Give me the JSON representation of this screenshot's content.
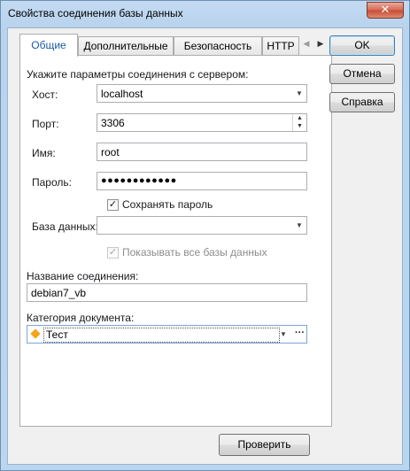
{
  "window": {
    "title": "Свойства соединения базы данных",
    "close_glyph": "✕"
  },
  "tabs": [
    {
      "label": "Общие",
      "active": true
    },
    {
      "label": "Дополнительные",
      "active": false
    },
    {
      "label": "Безопасность",
      "active": false
    },
    {
      "label": "HTTP",
      "active": false
    }
  ],
  "tab_scroll": {
    "left_glyph": "◀",
    "right_glyph": "▶"
  },
  "form": {
    "section_label": "Укажите параметры соединения с сервером:",
    "host": {
      "label": "Хост:",
      "value": "localhost"
    },
    "port": {
      "label": "Порт:",
      "value": "3306"
    },
    "user": {
      "label": "Имя:",
      "value": "root"
    },
    "password": {
      "label": "Пароль:",
      "value": "●●●●●●●●●●●●"
    },
    "save_password": {
      "label": "Сохранять пароль",
      "checked": true,
      "glyph": "✓"
    },
    "database": {
      "label": "База данных:",
      "value": ""
    },
    "show_all_databases": {
      "label": "Показывать все базы данных",
      "checked": true,
      "enabled": false,
      "glyph": "✓"
    },
    "connection_name": {
      "label": "Название соединения:",
      "value": "debian7_vb"
    },
    "doc_category": {
      "label": "Категория документа:",
      "value": "Тест",
      "icon": "orange-diamond-icon",
      "icon_color": "#f3a51b",
      "ellipsis": "···"
    }
  },
  "buttons": {
    "ok": "OK",
    "cancel": "Отмена",
    "help": "Справка",
    "test": "Проверить"
  },
  "glyphs": {
    "dropdown": "▼",
    "spin_up": "▲",
    "spin_down": "▼"
  },
  "colors": {
    "active_tab_text": "#1c5aa8",
    "title_bar": "#c3daf1",
    "close_button": "#c74a32"
  }
}
